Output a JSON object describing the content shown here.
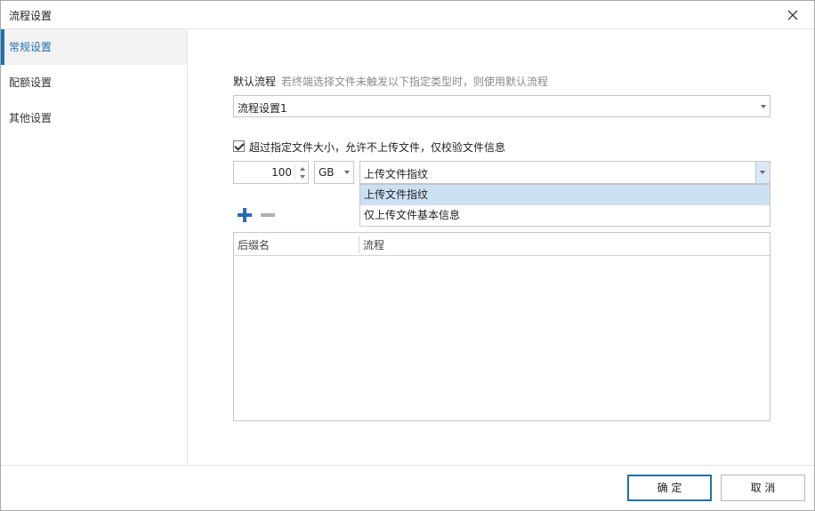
{
  "window": {
    "title": "流程设置"
  },
  "sidebar": {
    "items": [
      {
        "label": "常规设置",
        "active": true
      },
      {
        "label": "配额设置",
        "active": false
      },
      {
        "label": "其他设置",
        "active": false
      }
    ]
  },
  "main": {
    "default_flow_label": "默认流程",
    "default_flow_hint": "若终端选择文件未触发以下指定类型时，则使用默认流程",
    "default_flow_value": "流程设置1",
    "size_checkbox": {
      "checked": true,
      "label": "超过指定文件大小，允许不上传文件，仅校验文件信息"
    },
    "size_value": "100",
    "size_unit": "GB",
    "upload_mode": {
      "value": "上传文件指纹",
      "options": [
        "上传文件指纹",
        "仅上传文件基本信息"
      ],
      "highlighted": "上传文件指纹"
    },
    "table": {
      "columns": [
        "后缀名",
        "流程"
      ],
      "rows": []
    }
  },
  "footer": {
    "ok_label": "确 定",
    "cancel_label": "取 消"
  },
  "colors": {
    "accent": "#1f6fb2",
    "selected_option_bg": "#cce0f4",
    "add_icon": "#2a6bb5"
  },
  "icons": {
    "close": "close-icon",
    "add": "plus-icon",
    "remove": "minus-icon",
    "dropdown": "chevron-down-icon"
  }
}
